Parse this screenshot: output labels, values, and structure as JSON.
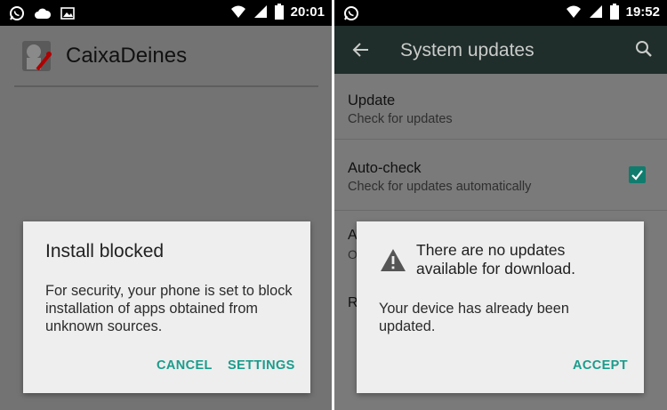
{
  "left_screen": {
    "status_bar": {
      "time": "20:01"
    },
    "app": {
      "name": "CaixaDeines"
    },
    "dialog": {
      "title": "Install blocked",
      "message": "For security, your phone is set to block installation of apps obtained from unknown sources.",
      "buttons": {
        "cancel": "CANCEL",
        "settings": "SETTINGS"
      }
    }
  },
  "right_screen": {
    "status_bar": {
      "time": "19:52"
    },
    "toolbar": {
      "title": "System updates"
    },
    "settings": [
      {
        "title": "Update",
        "subtitle": "Check for updates"
      },
      {
        "title": "Auto-check",
        "subtitle": "Check for updates automatically",
        "checked": true
      }
    ],
    "partial_rows": [
      "A",
      "O",
      "R"
    ],
    "dialog": {
      "title": "There are no updates available for download.",
      "message": "Your device has already been updated.",
      "buttons": {
        "accept": "ACCEPT"
      }
    }
  },
  "colors": {
    "accent": "#1a9c8c",
    "checkbox": "#107c6e",
    "toolbar": "#1f2d2b",
    "dim_background": "#737373"
  }
}
